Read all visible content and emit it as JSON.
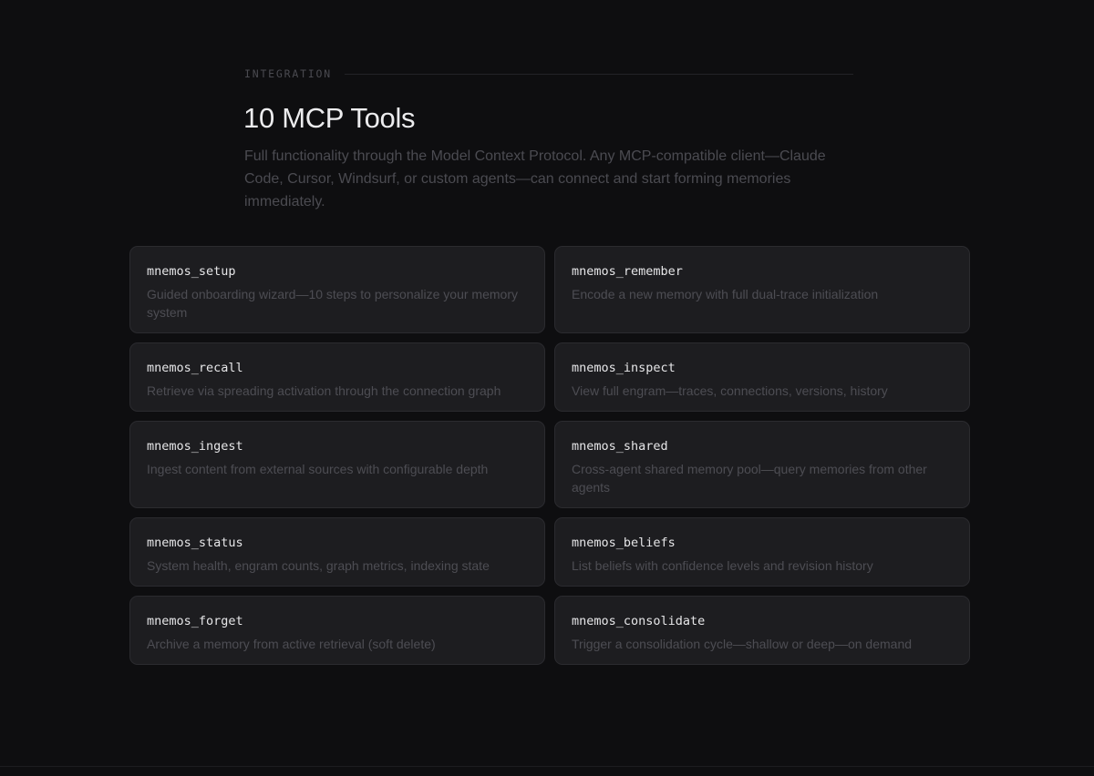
{
  "section": {
    "eyebrow": "INTEGRATION",
    "title": "10 MCP Tools",
    "description": "Full functionality through the Model Context Protocol. Any MCP-compatible client—Claude Code, Cursor, Windsurf, or custom agents—can connect and start forming memories immediately."
  },
  "tools": [
    {
      "name": "mnemos_setup",
      "description": "Guided onboarding wizard—10 steps to personalize your memory system"
    },
    {
      "name": "mnemos_remember",
      "description": "Encode a new memory with full dual-trace initialization"
    },
    {
      "name": "mnemos_recall",
      "description": "Retrieve via spreading activation through the connection graph"
    },
    {
      "name": "mnemos_inspect",
      "description": "View full engram—traces, connections, versions, history"
    },
    {
      "name": "mnemos_ingest",
      "description": "Ingest content from external sources with configurable depth"
    },
    {
      "name": "mnemos_shared",
      "description": "Cross-agent shared memory pool—query memories from other agents"
    },
    {
      "name": "mnemos_status",
      "description": "System health, engram counts, graph metrics, indexing state"
    },
    {
      "name": "mnemos_beliefs",
      "description": "List beliefs with confidence levels and revision history"
    },
    {
      "name": "mnemos_forget",
      "description": "Archive a memory from active retrieval (soft delete)"
    },
    {
      "name": "mnemos_consolidate",
      "description": "Trigger a consolidation cycle—shallow or deep—on demand"
    }
  ]
}
